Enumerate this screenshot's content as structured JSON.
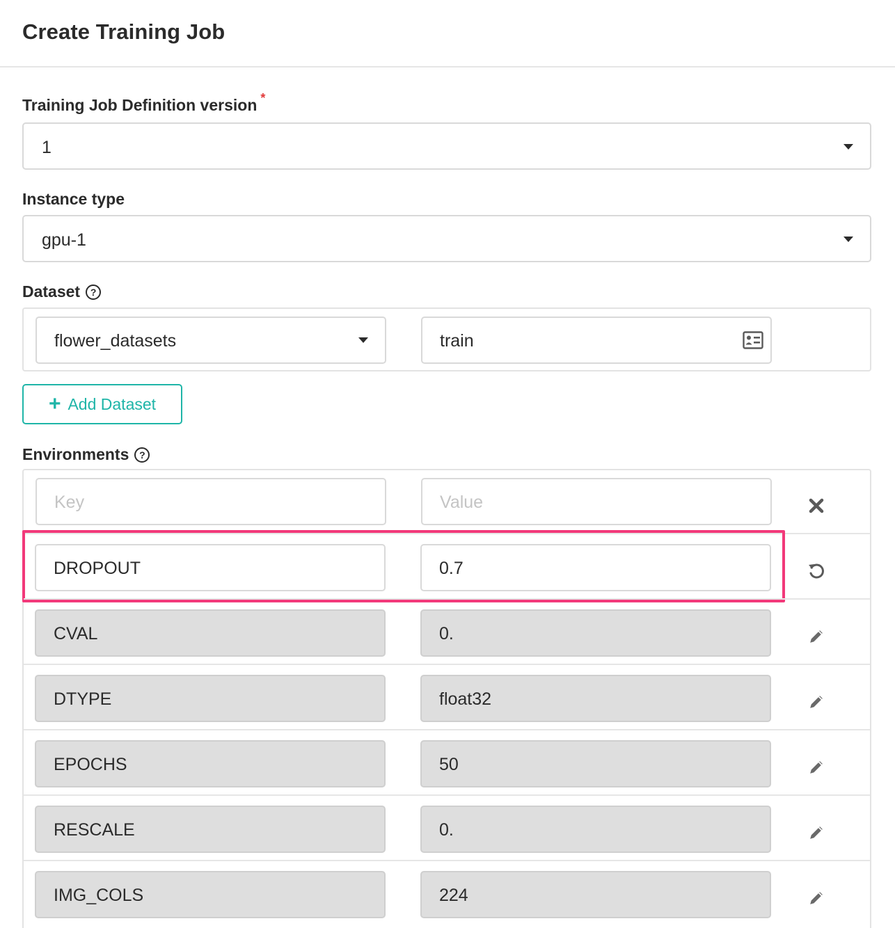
{
  "header": {
    "title": "Create Training Job"
  },
  "definition_version": {
    "label": "Training Job Definition version",
    "required_mark": "*",
    "value": "1"
  },
  "instance_type": {
    "label": "Instance type",
    "value": "gpu-1"
  },
  "dataset": {
    "label": "Dataset",
    "help_mark": "?",
    "name": "flower_datasets",
    "split": "train",
    "add_label": "Add Dataset",
    "add_icon": "+"
  },
  "environments": {
    "label": "Environments",
    "help_mark": "?",
    "new_entry": {
      "key_placeholder": "Key",
      "value_placeholder": "Value"
    },
    "editing": {
      "key": "DROPOUT",
      "value": "0.7"
    },
    "rows": [
      {
        "key": "CVAL",
        "value": "0."
      },
      {
        "key": "DTYPE",
        "value": "float32"
      },
      {
        "key": "EPOCHS",
        "value": "50"
      },
      {
        "key": "RESCALE",
        "value": "0."
      },
      {
        "key": "IMG_COLS",
        "value": "224"
      }
    ]
  },
  "colors": {
    "accent": "#1fb5a8",
    "highlight": "#f2397a",
    "required": "#e23b3b"
  }
}
